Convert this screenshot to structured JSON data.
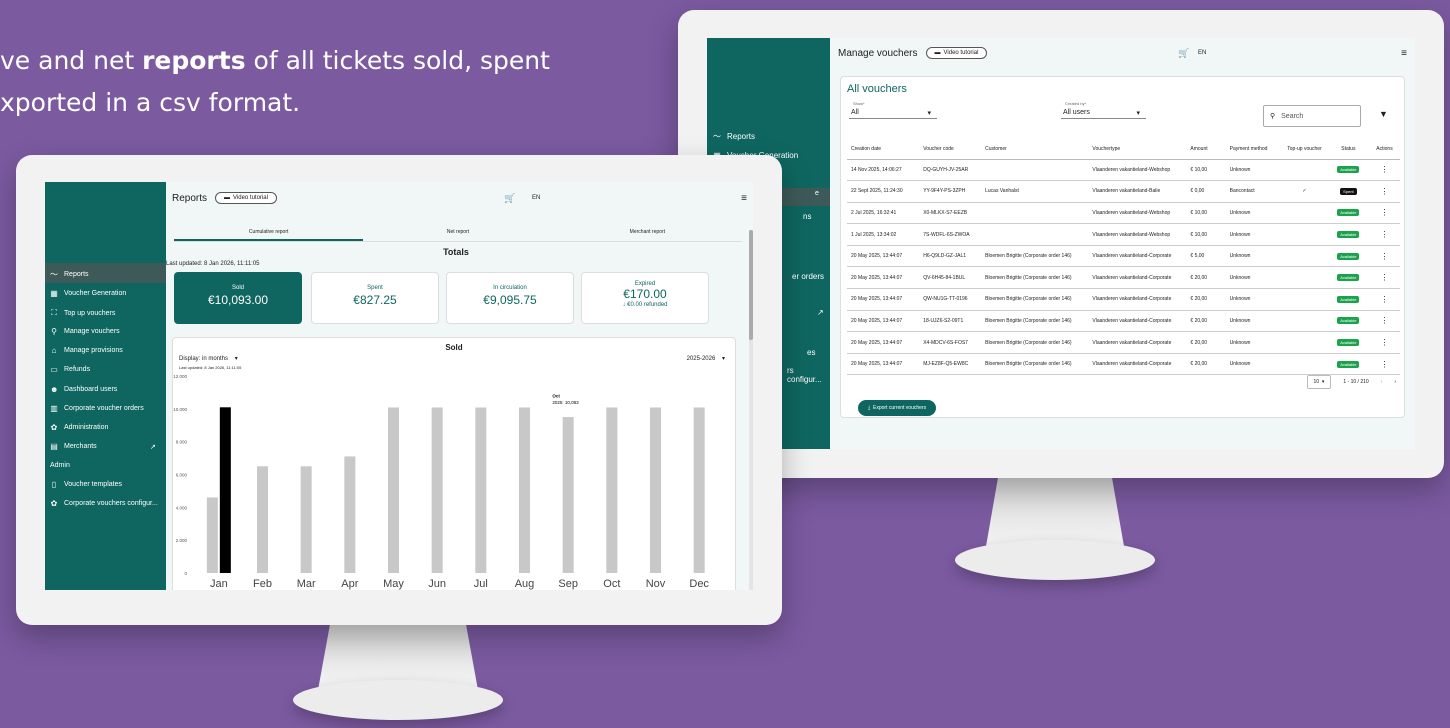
{
  "headline": {
    "line1_pre": "ve and net ",
    "line1_bold": "reports",
    "line1_post": " of all tickets sold, spent",
    "line2": "xported in a csv format."
  },
  "colors": {
    "brand": "#0f6660",
    "background": "#7b5aa0",
    "available": "#1aa34a"
  },
  "back_app": {
    "title": "Manage vouchers",
    "video_btn": "Video tutorial",
    "lang": "EN",
    "sidebar": [
      "Reports",
      "Voucher Generation",
      "ns",
      "er orders",
      "es",
      "rs configur..."
    ],
    "card_title": "All vouchers",
    "show_label": "Show*",
    "show_value": "All",
    "created_label": "Created by*",
    "created_value": "All users",
    "search_placeholder": "Search",
    "columns": [
      "Creation date",
      "Voucher code",
      "Customer",
      "Vouchertype",
      "Amount",
      "Payment method",
      "Top-up voucher",
      "Status",
      "Actions"
    ],
    "rows": [
      {
        "date": "14 Nov 2025, 14:06:27",
        "code": "DQ-GUYH-JV-25AR",
        "customer": "",
        "type": "Vlaanderen vakantieland-Webshop",
        "amount": "€ 10,00",
        "payment": "Unknown",
        "topup": "",
        "status": "Available"
      },
      {
        "date": "22 Sept 2025, 11:24:30",
        "code": "YY-9F4Y-PS-3ZPH",
        "customer": "Lucas Vanhalst",
        "type": "Vlaanderen vakantieland-Balie",
        "amount": "€ 0,00",
        "payment": "Bancontact",
        "topup": "✓",
        "status": "Spent"
      },
      {
        "date": "2 Jul 2025, 16:32:41",
        "code": "X0-MLKX-S7-EEZB",
        "customer": "",
        "type": "Vlaanderen vakantieland-Webshop",
        "amount": "€ 10,00",
        "payment": "Unknown",
        "topup": "",
        "status": "Available"
      },
      {
        "date": "1 Jul 2025, 13:34:02",
        "code": "7S-WDFL-6S-ZWOA",
        "customer": "",
        "type": "Vlaanderen vakantieland-Webshop",
        "amount": "€ 10,00",
        "payment": "Unknown",
        "topup": "",
        "status": "Available"
      },
      {
        "date": "20 May 2025, 13:44:07",
        "code": "H6-Q9LD-GZ-JAL1",
        "customer": "Bloemen Brigitte (Corporate order 146)",
        "type": "Vlaanderen vakantieland-Corporate",
        "amount": "€ 5,00",
        "payment": "Unknown",
        "topup": "",
        "status": "Available"
      },
      {
        "date": "20 May 2025, 13:44:07",
        "code": "QV-6H45-84-1BUL",
        "customer": "Bloemen Brigitte (Corporate order 146)",
        "type": "Vlaanderen vakantieland-Corporate",
        "amount": "€ 20,00",
        "payment": "Unknown",
        "topup": "",
        "status": "Available"
      },
      {
        "date": "20 May 2025, 13:44:07",
        "code": "QW-NU1G-TT-0196",
        "customer": "Bloemen Brigitte (Corporate order 146)",
        "type": "Vlaanderen vakantieland-Corporate",
        "amount": "€ 20,00",
        "payment": "Unknown",
        "topup": "",
        "status": "Available"
      },
      {
        "date": "20 May 2025, 13:44:07",
        "code": "18-UJZ6-S2-09T1",
        "customer": "Bloemen Brigitte (Corporate order 146)",
        "type": "Vlaanderen vakantieland-Corporate",
        "amount": "€ 20,00",
        "payment": "Unknown",
        "topup": "",
        "status": "Available"
      },
      {
        "date": "20 May 2025, 13:44:07",
        "code": "X4-MDCV-6S-FOS7",
        "customer": "Bloemen Brigitte (Corporate order 146)",
        "type": "Vlaanderen vakantieland-Corporate",
        "amount": "€ 20,00",
        "payment": "Unknown",
        "topup": "",
        "status": "Available"
      },
      {
        "date": "20 May 2025, 13:44:07",
        "code": "MJ-EZ8F-Q5-EW8C",
        "customer": "Bloemen Brigitte (Corporate order 146)",
        "type": "Vlaanderen vakantieland-Corporate",
        "amount": "€ 20,00",
        "payment": "Unknown",
        "topup": "",
        "status": "Available"
      }
    ],
    "rows_per_page": "10",
    "range": "1 - 10 / 210",
    "export_btn": "Export current vouchers"
  },
  "front_app": {
    "title": "Reports",
    "video_btn": "Video tutorial",
    "lang": "EN",
    "sidebar": {
      "reports": "Reports",
      "voucher_generation": "Voucher Generation",
      "top_up": "Top up vouchers",
      "manage_vouchers": "Manage vouchers",
      "manage_provisions": "Manage provisions",
      "refunds": "Refunds",
      "dashboard_users": "Dashboard users",
      "corporate_orders": "Corporate voucher orders",
      "administration": "Administration",
      "merchants": "Merchants",
      "admin_header": "Admin",
      "voucher_templates": "Voucher templates",
      "corporate_config": "Corporate vouchers configur..."
    },
    "tabs": [
      "Cumulative report",
      "Net report",
      "Merchant report"
    ],
    "totals_title": "Totals",
    "last_updated": "Last updated: 8 Jan 2026, 11:11:05",
    "kpis": [
      {
        "label": "Sold",
        "value": "€10,093.00"
      },
      {
        "label": "Spent",
        "value": "€827.25"
      },
      {
        "label": "In circulation",
        "value": "€9,095.75"
      },
      {
        "label": "Expired",
        "value": "€170.00",
        "sub": "↓ €0.00 refunded"
      }
    ],
    "chart_title": "Sold",
    "display_label": "Display:  in months",
    "chart_updated": "Last updated: 8 Jan 2026, 11:11:05",
    "year_select": "2025-2026",
    "tooltip_month": "Oct",
    "tooltip_value": "2025: 10,083"
  },
  "chart_data": {
    "type": "bar",
    "title": "Sold",
    "categories": [
      "Jan",
      "Feb",
      "Mar",
      "Apr",
      "May",
      "Jun",
      "Jul",
      "Aug",
      "Sep",
      "Oct",
      "Nov",
      "Dec"
    ],
    "series": [
      {
        "values": [
          4600,
          6500,
          6500,
          7100,
          10083,
          10083,
          10083,
          10083,
          9500,
          10083,
          10083,
          10083
        ],
        "color": "#c8c8c8"
      },
      {
        "values": [
          10093,
          null,
          null,
          null,
          null,
          null,
          null,
          null,
          null,
          null,
          null,
          null
        ],
        "color": "#000000"
      }
    ],
    "yticks": [
      0,
      2000,
      4000,
      6000,
      8000,
      10000,
      12000
    ],
    "ytick_labels": [
      "0",
      "2.000",
      "4.000",
      "6.000",
      "8.000",
      "10.000",
      "12.000"
    ],
    "ylim": [
      0,
      12000
    ],
    "grid": false,
    "legend": "none"
  }
}
